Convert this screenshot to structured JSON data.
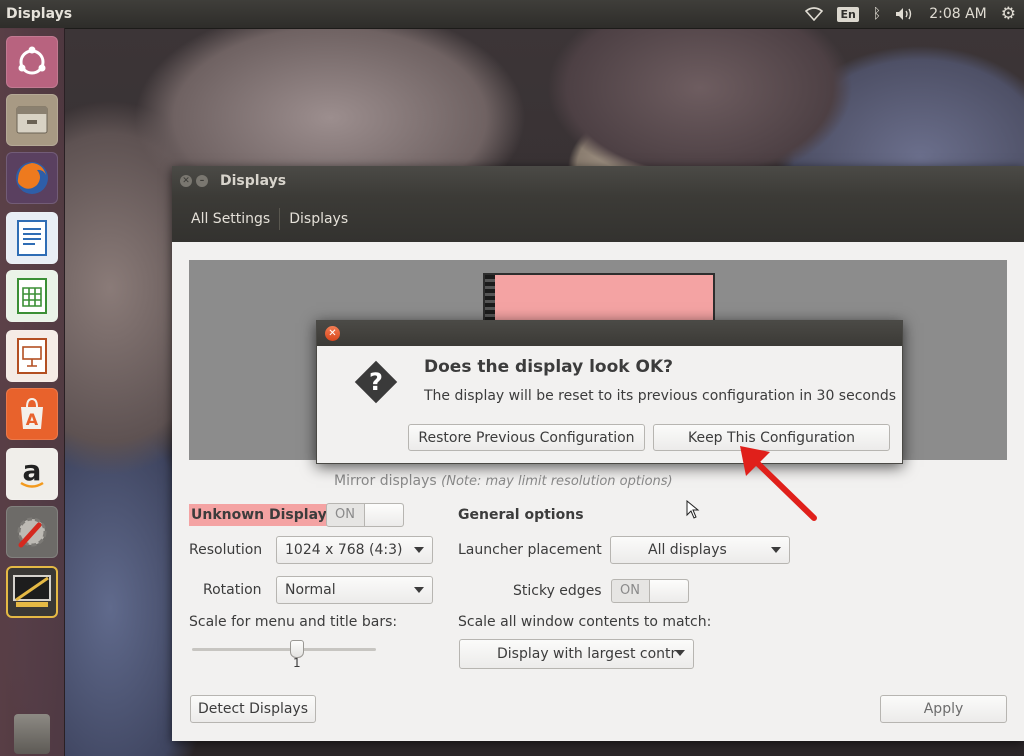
{
  "top_panel": {
    "app_title": "Displays",
    "indicators": [
      {
        "name": "wifi-icon",
        "glyph": "◇"
      },
      {
        "name": "keyboard-layout",
        "text": "En"
      },
      {
        "name": "bluetooth-icon",
        "glyph": "ᛒ"
      },
      {
        "name": "volume-icon",
        "glyph": "🔊"
      }
    ],
    "clock": "2:08 AM",
    "session_icon": "⚙"
  },
  "launcher": {
    "items": [
      {
        "name": "ubuntu-dash",
        "glyph": "◉",
        "color": "#c06a88"
      },
      {
        "name": "files",
        "glyph": "▤",
        "color": "#b8a98f"
      },
      {
        "name": "firefox",
        "glyph": "◕",
        "color": "#e36a1d"
      },
      {
        "name": "libreoffice-writer",
        "glyph": "≡",
        "color": "#3a78c2"
      },
      {
        "name": "libreoffice-calc",
        "glyph": "▦",
        "color": "#3f9a3b"
      },
      {
        "name": "libreoffice-impress",
        "glyph": "▣",
        "color": "#c05a2a"
      },
      {
        "name": "ubuntu-software",
        "glyph": "A",
        "color": "#e36a3a"
      },
      {
        "name": "amazon",
        "glyph": "a",
        "color": "#e8e6e2"
      },
      {
        "name": "system-settings",
        "glyph": "✎",
        "color": "#8a8a8a"
      },
      {
        "name": "displays",
        "glyph": "▭",
        "color": "#d9b43b"
      }
    ]
  },
  "window": {
    "title": "Displays",
    "breadcrumbs": [
      "All Settings",
      "Displays"
    ]
  },
  "form": {
    "mirror_displays": "Mirror displays",
    "mirror_note": "(Note: may limit resolution options)",
    "display_name": "Unknown Display",
    "display_switch": "ON",
    "resolution_label": "Resolution",
    "resolution_value": "1024 x 768 (4:3)",
    "rotation_label": "Rotation",
    "rotation_value": "Normal",
    "scale_label": "Scale for menu and title bars:",
    "scale_value": "1",
    "general_options": "General options",
    "launcher_placement_label": "Launcher placement",
    "launcher_placement_value": "All displays",
    "sticky_edges_label": "Sticky edges",
    "sticky_edges_switch": "ON",
    "scale_contents_label": "Scale all window contents to match:",
    "scale_contents_value": "Display with largest contr",
    "detect_button": "Detect Displays",
    "apply_button": "Apply"
  },
  "dialog": {
    "heading": "Does the display look OK?",
    "body": "The display will be reset to its previous configuration in 30 seconds",
    "restore_button": "Restore Previous Configuration",
    "keep_button": "Keep This Configuration"
  },
  "colors": {
    "display_highlight": "#f4a3a3",
    "annotation_arrow": "#e0201b"
  }
}
